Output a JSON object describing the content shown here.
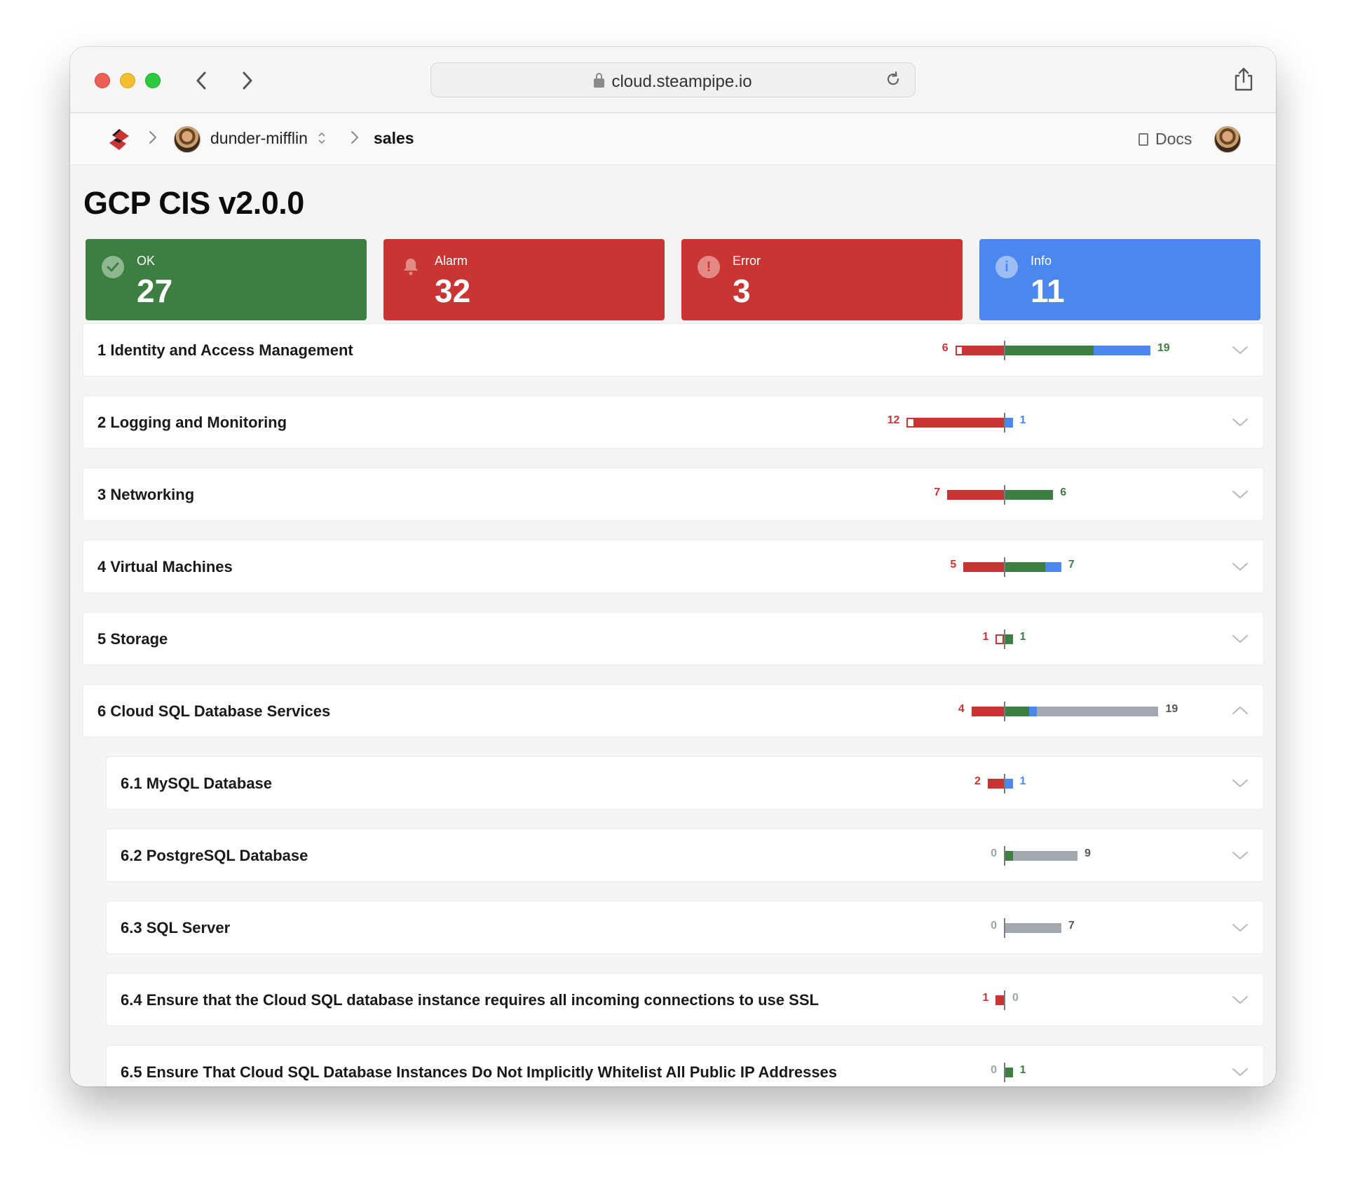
{
  "browser": {
    "url": "cloud.steampipe.io"
  },
  "app": {
    "org": "dunder-mifflin",
    "workspace": "sales",
    "docs_label": "Docs"
  },
  "page": {
    "title": "GCP CIS v2.0.0"
  },
  "summary": [
    {
      "key": "ok",
      "label": "OK",
      "value": "27",
      "color": "#3d7f42"
    },
    {
      "key": "alarm",
      "label": "Alarm",
      "value": "32",
      "color": "#c93532"
    },
    {
      "key": "error",
      "label": "Error",
      "value": "3",
      "color": "#c93532"
    },
    {
      "key": "info",
      "label": "Info",
      "value": "11",
      "color": "#4a87ee"
    }
  ],
  "colors": {
    "ok": "#3d7f42",
    "alarm": "#c93532",
    "info": "#4a87ee",
    "skip": "#a3a8b0"
  },
  "sections": [
    {
      "title": "1 Identity and Access Management",
      "alarm": 5,
      "error": 1,
      "ok": 11,
      "info": 7,
      "skip": 0,
      "left_label": "6",
      "right_label": "19",
      "right_color": "green",
      "expanded": false,
      "level": 0
    },
    {
      "title": "2 Logging and Monitoring",
      "alarm": 11,
      "error": 1,
      "ok": 0,
      "info": 1,
      "skip": 0,
      "left_label": "12",
      "right_label": "1",
      "right_color": "blue",
      "expanded": false,
      "level": 0
    },
    {
      "title": "3 Networking",
      "alarm": 7,
      "error": 0,
      "ok": 6,
      "info": 0,
      "skip": 0,
      "left_label": "7",
      "right_label": "6",
      "right_color": "green",
      "expanded": false,
      "level": 0
    },
    {
      "title": "4 Virtual Machines",
      "alarm": 5,
      "error": 0,
      "ok": 5,
      "info": 2,
      "skip": 0,
      "left_label": "5",
      "right_label": "7",
      "right_color": "green",
      "expanded": false,
      "level": 0
    },
    {
      "title": "5 Storage",
      "alarm": 0,
      "error": 1,
      "ok": 1,
      "info": 0,
      "skip": 0,
      "left_label": "1",
      "right_label": "1",
      "right_color": "green",
      "expanded": false,
      "level": 0
    },
    {
      "title": "6 Cloud SQL Database Services",
      "alarm": 4,
      "error": 0,
      "ok": 3,
      "info": 1,
      "skip": 15,
      "left_label": "4",
      "right_label": "19",
      "right_color": "grey",
      "expanded": true,
      "level": 0
    },
    {
      "title": "6.1 MySQL Database",
      "alarm": 2,
      "error": 0,
      "ok": 0,
      "info": 1,
      "skip": 0,
      "left_label": "2",
      "right_label": "1",
      "right_color": "blue",
      "expanded": false,
      "level": 1
    },
    {
      "title": "6.2 PostgreSQL Database",
      "alarm": 0,
      "error": 0,
      "ok": 1,
      "info": 0,
      "skip": 8,
      "left_label": "0",
      "right_label": "9",
      "right_color": "dark",
      "expanded": false,
      "level": 1
    },
    {
      "title": "6.3 SQL Server",
      "alarm": 0,
      "error": 0,
      "ok": 0,
      "info": 0,
      "skip": 7,
      "left_label": "0",
      "right_label": "7",
      "right_color": "dark",
      "expanded": false,
      "level": 1
    },
    {
      "title": "6.4 Ensure that the Cloud SQL database instance requires all incoming connections to use SSL",
      "alarm": 1,
      "error": 0,
      "ok": 0,
      "info": 0,
      "skip": 0,
      "left_label": "1",
      "right_label": "0",
      "right_color": "greyzero",
      "expanded": false,
      "level": 1
    },
    {
      "title": "6.5 Ensure That Cloud SQL Database Instances Do Not Implicitly Whitelist All Public IP Addresses",
      "alarm": 0,
      "error": 0,
      "ok": 1,
      "info": 0,
      "skip": 0,
      "left_label": "0",
      "right_label": "1",
      "right_color": "green",
      "expanded": false,
      "level": 1
    }
  ]
}
